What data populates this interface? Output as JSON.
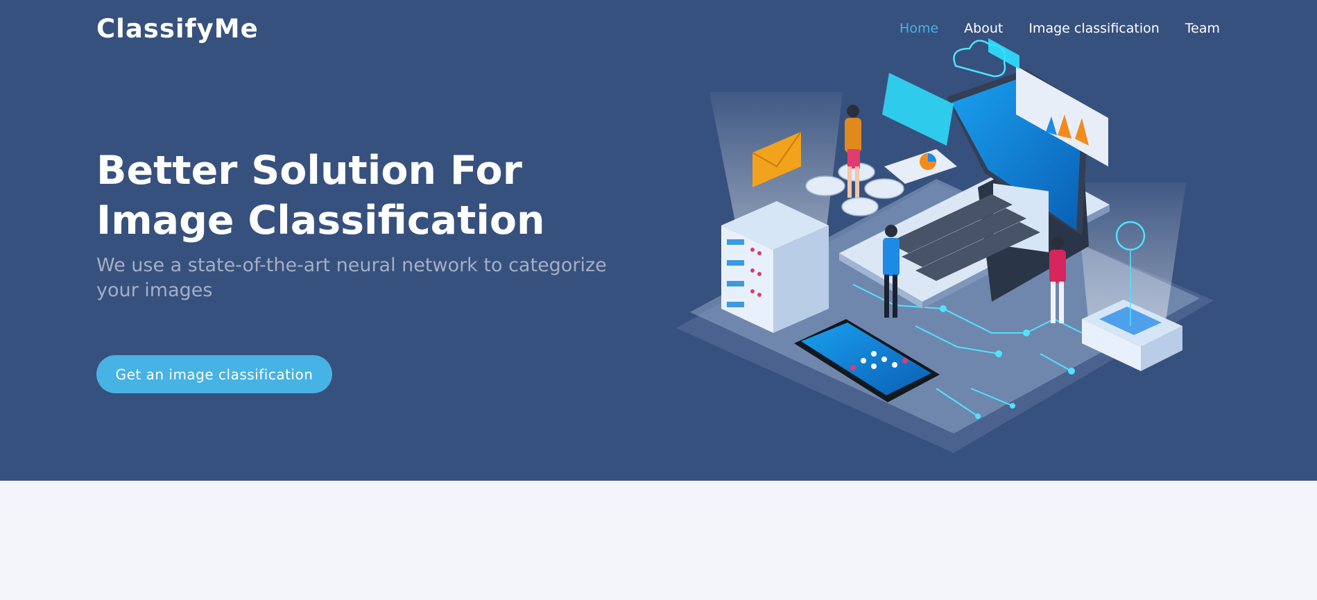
{
  "brand": {
    "name": "ClassifyMe"
  },
  "nav": {
    "items": [
      {
        "label": "Home",
        "active": true
      },
      {
        "label": "About",
        "active": false
      },
      {
        "label": "Image classification",
        "active": false
      },
      {
        "label": "Team",
        "active": false
      }
    ]
  },
  "hero": {
    "title": "Better Solution For Image Classification",
    "subtitle": "We use a state-of-the-art neural network to categorize your images",
    "cta_label": "Get an image classification"
  },
  "colors": {
    "hero_background": "#37517e",
    "accent": "#47b2e4",
    "page_background": "#f3f5fa",
    "subtitle_text": "#a4afc6"
  },
  "icons": {
    "hero_illustration": "isometric-laptop-servers-network-illustration"
  }
}
